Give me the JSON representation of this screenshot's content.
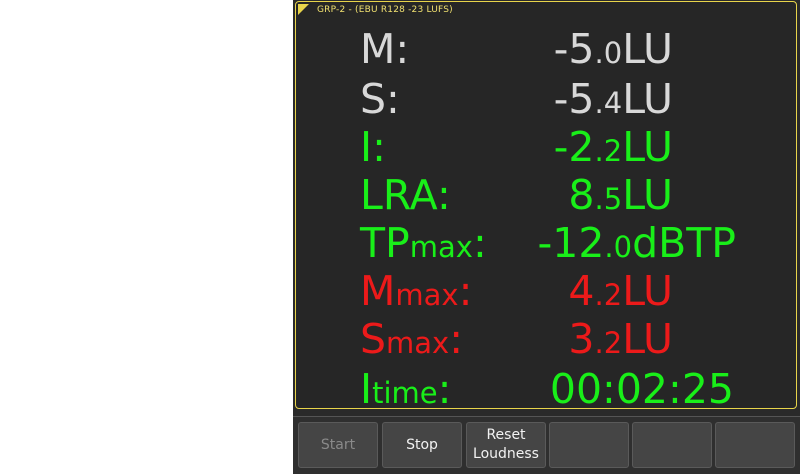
{
  "meter": {
    "title": "GRP-2 - (EBU R128 -23 LUFS)",
    "rows": [
      {
        "label": "M",
        "label_sub": "",
        "colon": ":",
        "int": "-5",
        "dec": ".0",
        "unit": "LU",
        "color": "#d8d8d8"
      },
      {
        "label": "S",
        "label_sub": "",
        "colon": ":",
        "int": "-5",
        "dec": ".4",
        "unit": "LU",
        "color": "#d8d8d8"
      },
      {
        "label": "I",
        "label_sub": "",
        "colon": ":",
        "int": "-2",
        "dec": ".2",
        "unit": "LU",
        "color": "#19ef19"
      },
      {
        "label": "LRA",
        "label_sub": "",
        "colon": ":",
        "int": "8",
        "dec": ".5",
        "unit": "LU",
        "color": "#19ef19"
      },
      {
        "label": "TP",
        "label_sub": "max",
        "colon": ":",
        "int": "-12",
        "dec": ".0",
        "unit": "dBTP",
        "color": "#19ef19"
      },
      {
        "label": "M",
        "label_sub": "max",
        "colon": ":",
        "int": "4",
        "dec": ".2",
        "unit": "LU",
        "color": "#ec1a1a"
      },
      {
        "label": "S",
        "label_sub": "max",
        "colon": ":",
        "int": "3",
        "dec": ".2",
        "unit": "LU",
        "color": "#ec1a1a"
      },
      {
        "label": "I",
        "label_sub": "time",
        "colon": ":",
        "int": "00:02:25",
        "dec": "",
        "unit": "",
        "color": "#19ef19"
      }
    ]
  },
  "buttons": {
    "start": "Start",
    "stop": "Stop",
    "reset_line1": "Reset",
    "reset_line2": "Loudness"
  },
  "colors": {
    "border": "#e8d44a",
    "title": "#f0e070"
  }
}
